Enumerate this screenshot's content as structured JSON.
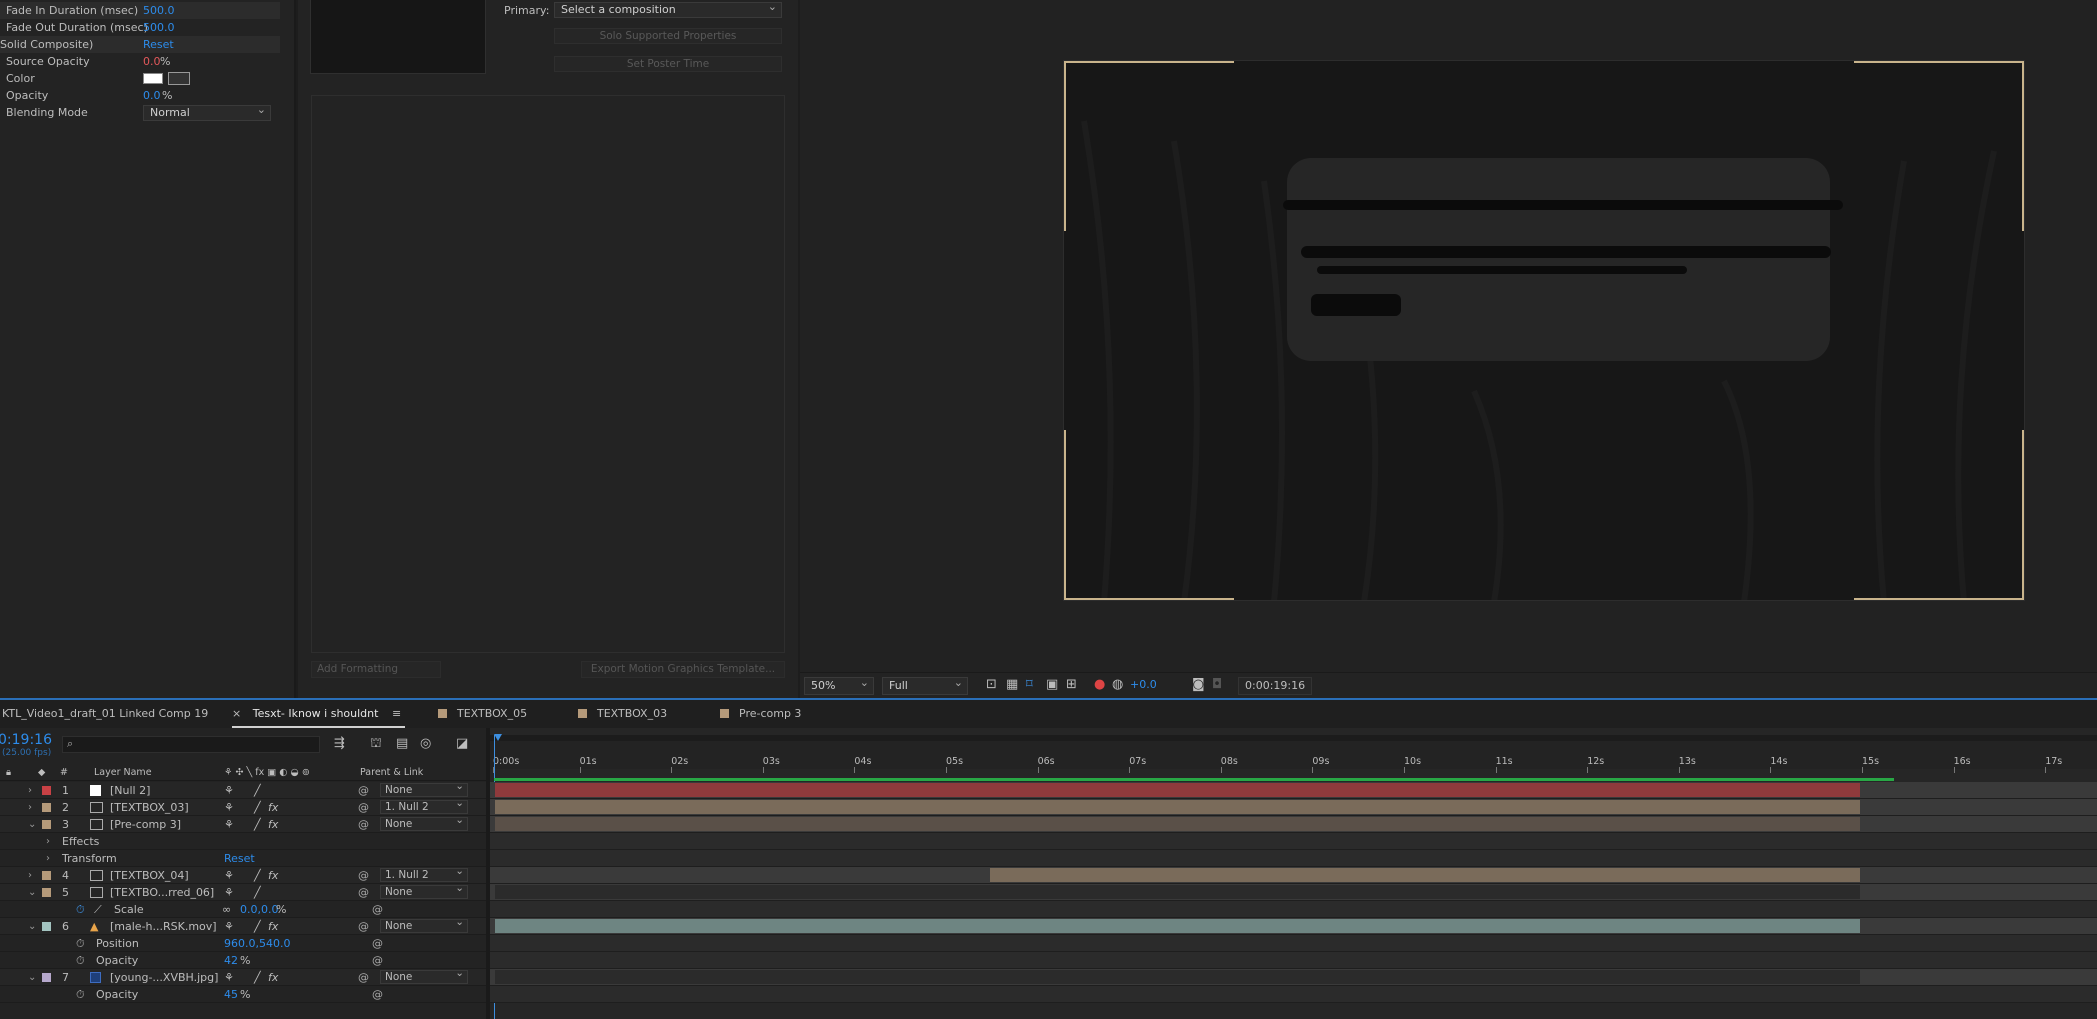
{
  "effect_controls": {
    "rows": [
      {
        "label": "Fade In Duration (msec)",
        "value": "500.0"
      },
      {
        "label": "Fade Out Duration (msec)",
        "value": "500.0"
      },
      {
        "label": "Solid Composite)",
        "value": "Reset"
      },
      {
        "label": "Source Opacity",
        "value": "0.0",
        "unit": "%"
      },
      {
        "label": "Color"
      },
      {
        "label": "Opacity",
        "value": "0.0",
        "unit": "%"
      },
      {
        "label": "Blending Mode",
        "value": "Normal"
      }
    ]
  },
  "essential_graphics": {
    "primary_label": "Primary:",
    "primary_value": "Select a composition",
    "solo_button": "Solo Supported Properties",
    "poster_button": "Set Poster Time",
    "add_formatting": "Add Formatting",
    "export_button": "Export Motion Graphics Template..."
  },
  "viewer": {
    "zoom": "50%",
    "resolution": "Full",
    "exposure": "+0.0",
    "timecode": "0:00:19:16"
  },
  "timeline": {
    "tabs": [
      {
        "label": "KTL_Video1_draft_01 Linked Comp 19",
        "color": "#232323"
      },
      {
        "label": "Tesxt- Iknow i shouldnt",
        "color": "#232323",
        "active": true,
        "close": "×",
        "menu": "≡"
      },
      {
        "label": "TEXTBOX_05",
        "color": "#b59a7a"
      },
      {
        "label": "TEXTBOX_03",
        "color": "#b59a7a"
      },
      {
        "label": "Pre-comp 3",
        "color": "#b59a7a"
      }
    ],
    "current_time": "0:19:16",
    "fps": "(25.00 fps)",
    "search_placeholder": "",
    "headers": {
      "num": "#",
      "layer_name": "Layer Name",
      "parent": "Parent & Link"
    },
    "ruler": [
      "0:00s",
      "01s",
      "02s",
      "03s",
      "04s",
      "05s",
      "06s",
      "07s",
      "08s",
      "09s",
      "10s",
      "11s",
      "12s",
      "13s",
      "14s",
      "15s",
      "16s",
      "17s"
    ],
    "rows": [
      {
        "kind": "layer",
        "num": "1",
        "name": "[Null 2]",
        "color": "#c84145",
        "icon": "null-icon",
        "fx": false,
        "parent": "None",
        "bar_color": "#8f3a3c",
        "bar_start": 0.0,
        "bar_end": 14.9
      },
      {
        "kind": "layer",
        "num": "2",
        "name": "[TEXTBOX_03]",
        "color": "#b59a7a",
        "icon": "comp-icon",
        "fx": true,
        "parent": "1. Null 2",
        "bar_color": "#7a6b5a",
        "bar_start": 0.0,
        "bar_end": 14.9
      },
      {
        "kind": "layer",
        "num": "3",
        "name": "[Pre-comp 3]",
        "color": "#b59a7a",
        "icon": "comp-icon",
        "fx": true,
        "parent": "None",
        "bar_color": "#5a5048",
        "bar_start": 0.0,
        "bar_end": 14.9,
        "open": true
      },
      {
        "kind": "group",
        "name": "Effects"
      },
      {
        "kind": "group",
        "name": "Transform",
        "value": "Reset"
      },
      {
        "kind": "layer",
        "num": "4",
        "name": "[TEXTBOX_04]",
        "color": "#b59a7a",
        "icon": "comp-icon",
        "fx": true,
        "parent": "1. Null 2",
        "bar_color": "#7a6b5a",
        "bar_start": 5.4,
        "bar_end": 14.9
      },
      {
        "kind": "layer",
        "num": "5",
        "name": "[TEXTBO...rred_06]",
        "color": "#b59a7a",
        "icon": "comp-icon",
        "fx": false,
        "parent": "None",
        "bar_color": "#2b2b2b",
        "bar_start": 0.0,
        "bar_end": 14.9,
        "open": true
      },
      {
        "kind": "prop",
        "name": "Scale",
        "value": "0.0,0.0",
        "unit": "%"
      },
      {
        "kind": "layer",
        "num": "6",
        "name": "[male-h...RSK.mov]",
        "color": "#a3c4c0",
        "icon": "footage-icon",
        "fx": true,
        "parent": "None",
        "bar_color": "#6e8582",
        "bar_start": 0.0,
        "bar_end": 14.9,
        "open": true
      },
      {
        "kind": "prop",
        "name": "Position",
        "value": "960.0,540.0"
      },
      {
        "kind": "prop",
        "name": "Opacity",
        "value": "42",
        "unit": "%"
      },
      {
        "kind": "layer",
        "num": "7",
        "name": "[young-...XVBH.jpg]",
        "color": "#b6a8cc",
        "icon": "ps-icon",
        "fx": true,
        "parent": "None",
        "bar_color": "#2b2b2b",
        "bar_start": 0.0,
        "bar_end": 14.9,
        "open": true
      },
      {
        "kind": "prop",
        "name": "Opacity",
        "value": "45",
        "unit": "%"
      }
    ]
  }
}
